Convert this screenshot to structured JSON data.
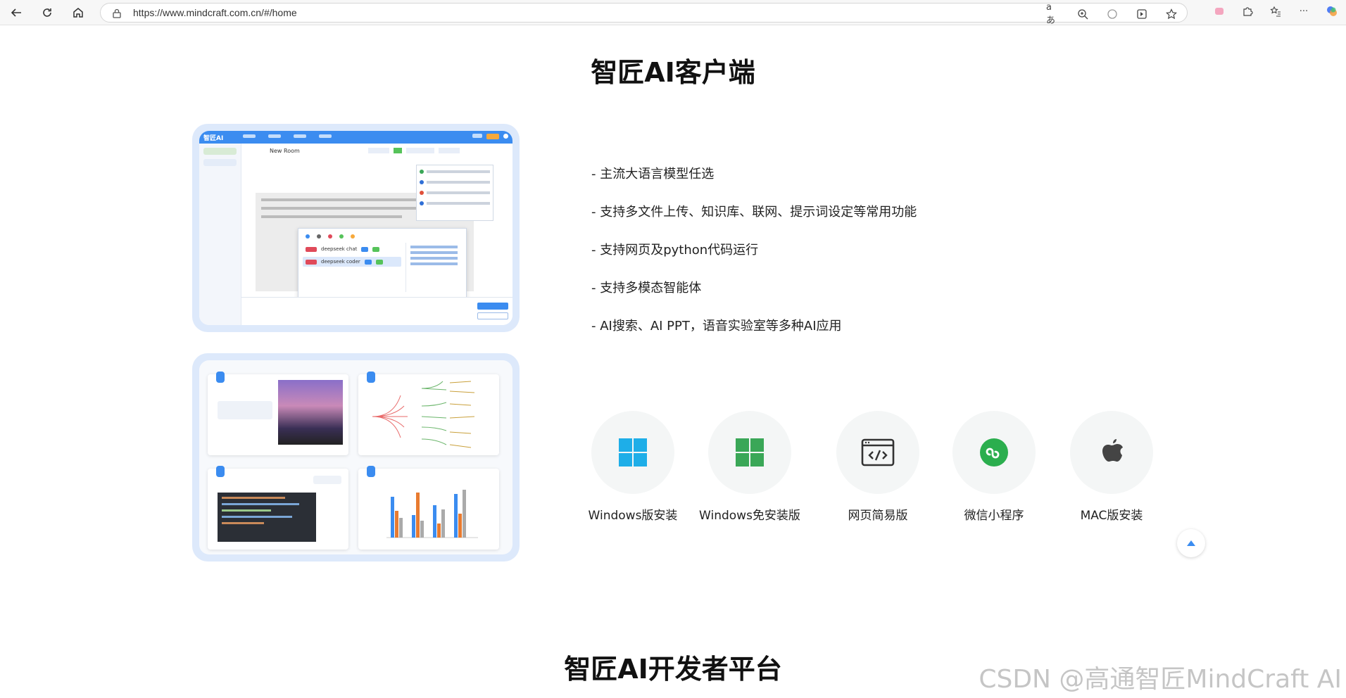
{
  "browser": {
    "url": "https://www.mindcraft.com.cn/#/home"
  },
  "page": {
    "title": "智匠AI客户端",
    "features": [
      "- 主流大语言模型任选",
      "- 支持多文件上传、知识库、联网、提示词设定等常用功能",
      "- 支持网页及python代码运行",
      "- 支持多模态智能体",
      "- AI搜索、AI PPT，语音实验室等多种AI应用"
    ],
    "downloads": [
      {
        "label": "Windows版安装",
        "icon": "windows-icon",
        "color": "#1eaee8"
      },
      {
        "label": "Windows免安装版",
        "icon": "windows-icon",
        "color": "#3aa757"
      },
      {
        "label": "网页简易版",
        "icon": "code-window-icon",
        "color": "#333333"
      },
      {
        "label": "微信小程序",
        "icon": "miniprogram-icon",
        "color": "#2bae4e"
      },
      {
        "label": "MAC版安装",
        "icon": "apple-icon",
        "color": "#444444"
      }
    ],
    "next_section_title": "智匠AI开发者平台",
    "watermark": "CSDN @高通智匠MindCraft AI"
  },
  "mockup": {
    "logo": "智匠AI",
    "room_title": "New Room",
    "model_row_1": "deepseek chat",
    "model_row_2": "deepseek coder"
  },
  "colors": {
    "accent": "#3b8cf0",
    "frame": "#dde9fb"
  }
}
